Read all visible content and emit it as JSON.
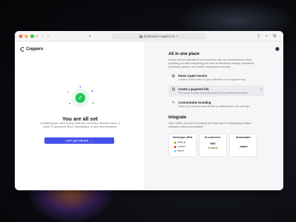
{
  "browser": {
    "url": "dashboard.copperx.io/"
  },
  "app": {
    "logo_text": "Copperx"
  },
  "left": {
    "title": "You are all set",
    "description": "Everything you need to jump-start your business. Whether you're a SaaS, E-commerce Store, Marketplace, or any other business.",
    "cta_label": "Let's get started",
    "cta_icon": "arrow-right-icon",
    "page_number": "3"
  },
  "right": {
    "overview": {
      "title": "All in one place",
      "description": "Unlock the full potential of your business with our comprehensive suite, providing you with everything you need to effectively manage operations, accelerate growth, and achieve remarkable success."
    },
    "features": [
      {
        "icon": "receipt-icon",
        "title": "Raise crypto invoice",
        "desc": "Create & send invoice to your customers in an organized way."
      },
      {
        "icon": "link-icon",
        "title": "Create a payment link",
        "desc": "The smart no-code way to get paid for your goods and services."
      },
      {
        "icon": "brush-icon",
        "title": "Customizable branding",
        "desc": "Define your brand's visual identity by setting brand color and logo."
      }
    ],
    "integrate": {
      "title": "Integrate",
      "description": "Save 1000s of hours of development time spent in integrating multiple networks, tokens and wallets.",
      "cards": [
        {
          "title": "Developer APIs",
          "items": [
            "Node.js",
            "Laravel",
            "React"
          ],
          "colors": [
            "#6cc24a",
            "#ff2d20",
            "#61dafb"
          ]
        },
        {
          "title": "E-commerce",
          "brands": [
            "WIX",
            "shopify"
          ],
          "colors": [
            "#111111",
            "#5e8e3e"
          ]
        },
        {
          "title": "Automation",
          "brands": [
            "_zapier"
          ],
          "colors": [
            "#222222"
          ]
        }
      ]
    }
  },
  "colors": {
    "accent": "#4452e8",
    "success": "#22c55e"
  }
}
